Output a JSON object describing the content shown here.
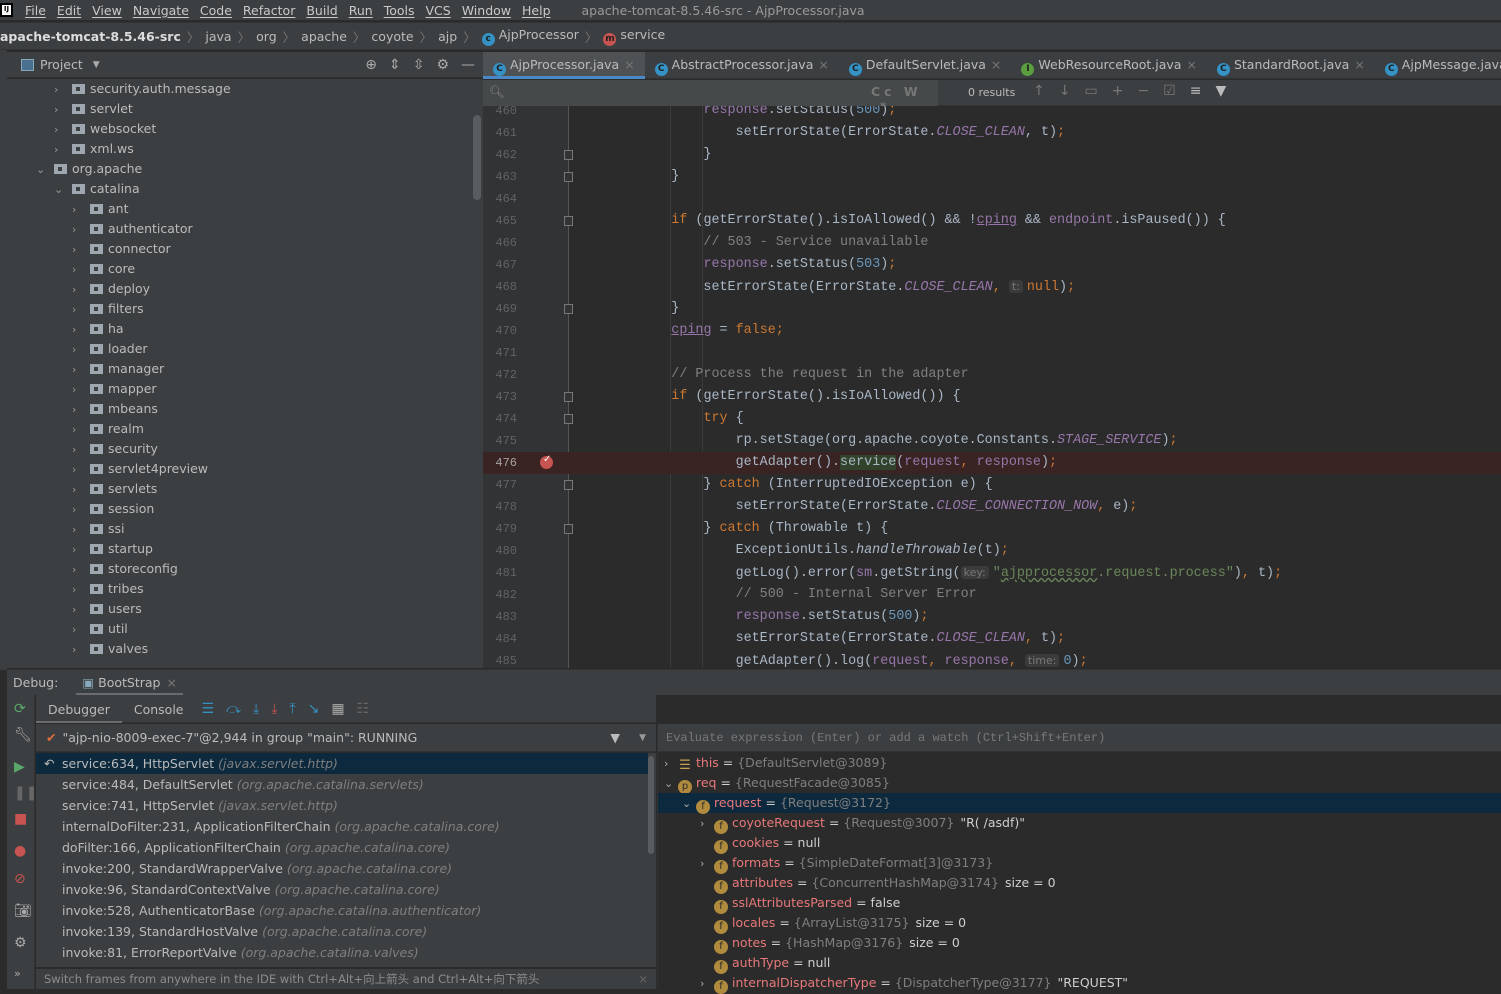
{
  "menu": {
    "items": [
      "File",
      "Edit",
      "View",
      "Navigate",
      "Code",
      "Refactor",
      "Build",
      "Run",
      "Tools",
      "VCS",
      "Window",
      "Help"
    ],
    "window_title": "apache-tomcat-8.5.46-src - AjpProcessor.java"
  },
  "breadcrumb": {
    "items": [
      "apache-tomcat-8.5.46-src",
      "java",
      "org",
      "apache",
      "coyote",
      "ajp"
    ],
    "class": "AjpProcessor",
    "method": "service"
  },
  "project": {
    "title": "Project",
    "tree": [
      {
        "label": "security.auth.message",
        "level": 2,
        "open": false
      },
      {
        "label": "servlet",
        "level": 2,
        "open": false
      },
      {
        "label": "websocket",
        "level": 2,
        "open": false
      },
      {
        "label": "xml.ws",
        "level": 2,
        "open": false
      },
      {
        "label": "org.apache",
        "level": 1,
        "open": true
      },
      {
        "label": "catalina",
        "level": 2,
        "open": true
      },
      {
        "label": "ant",
        "level": 3,
        "open": false
      },
      {
        "label": "authenticator",
        "level": 3,
        "open": false
      },
      {
        "label": "connector",
        "level": 3,
        "open": false
      },
      {
        "label": "core",
        "level": 3,
        "open": false
      },
      {
        "label": "deploy",
        "level": 3,
        "open": false
      },
      {
        "label": "filters",
        "level": 3,
        "open": false
      },
      {
        "label": "ha",
        "level": 3,
        "open": false
      },
      {
        "label": "loader",
        "level": 3,
        "open": false
      },
      {
        "label": "manager",
        "level": 3,
        "open": false
      },
      {
        "label": "mapper",
        "level": 3,
        "open": false
      },
      {
        "label": "mbeans",
        "level": 3,
        "open": false
      },
      {
        "label": "realm",
        "level": 3,
        "open": false
      },
      {
        "label": "security",
        "level": 3,
        "open": false
      },
      {
        "label": "servlet4preview",
        "level": 3,
        "open": false
      },
      {
        "label": "servlets",
        "level": 3,
        "open": false
      },
      {
        "label": "session",
        "level": 3,
        "open": false
      },
      {
        "label": "ssi",
        "level": 3,
        "open": false
      },
      {
        "label": "startup",
        "level": 3,
        "open": false
      },
      {
        "label": "storeconfig",
        "level": 3,
        "open": false
      },
      {
        "label": "tribes",
        "level": 3,
        "open": false
      },
      {
        "label": "users",
        "level": 3,
        "open": false
      },
      {
        "label": "util",
        "level": 3,
        "open": false
      },
      {
        "label": "valves",
        "level": 3,
        "open": false
      }
    ]
  },
  "tabs": [
    {
      "label": "AjpProcessor.java",
      "icon": "c",
      "active": true
    },
    {
      "label": "AbstractProcessor.java",
      "icon": "c"
    },
    {
      "label": "DefaultServlet.java",
      "icon": "c"
    },
    {
      "label": "WebResourceRoot.java",
      "icon": "i"
    },
    {
      "label": "StandardRoot.java",
      "icon": "c"
    },
    {
      "label": "AjpMessage.java",
      "icon": "c"
    }
  ],
  "search": {
    "value": "",
    "options": "Cc W .*",
    "results": "0 results"
  },
  "colors": {
    "keyword": "#cc7832",
    "field": "#9876aa",
    "number": "#6897bb",
    "string": "#6a8759",
    "comment": "#808080",
    "text": "#a9b7c6",
    "breakpoint": "#c75450",
    "accent": "#4a88c7"
  },
  "code": [
    {
      "n": "460",
      "t": [
        [
          "            ",
          "d"
        ],
        [
          "response",
          "f"
        ],
        [
          ".setStatus(",
          "d"
        ],
        [
          "500",
          "n"
        ],
        [
          ")",
          "d"
        ],
        [
          ";",
          "k"
        ]
      ]
    },
    {
      "n": "461",
      "t": [
        [
          "                setErrorState(ErrorState.",
          "d"
        ],
        [
          "CLOSE_CLEAN",
          "ci"
        ],
        [
          ", t)",
          "d"
        ],
        [
          ";",
          "k"
        ]
      ]
    },
    {
      "n": "462",
      "fold": true,
      "t": [
        [
          "            }",
          "d"
        ]
      ]
    },
    {
      "n": "463",
      "fold": true,
      "t": [
        [
          "        }",
          "d"
        ]
      ]
    },
    {
      "n": "464",
      "t": []
    },
    {
      "n": "465",
      "fold": true,
      "t": [
        [
          "        ",
          "d"
        ],
        [
          "if",
          "k"
        ],
        [
          " (getErrorState().isIoAllowed() && !",
          "d"
        ],
        [
          "cping",
          "fu"
        ],
        [
          " && ",
          "d"
        ],
        [
          "endpoint",
          "f"
        ],
        [
          ".isPaused()) {",
          "d"
        ]
      ]
    },
    {
      "n": "466",
      "t": [
        [
          "            // 503 - Service unavailable",
          "c"
        ]
      ]
    },
    {
      "n": "467",
      "t": [
        [
          "            ",
          "d"
        ],
        [
          "response",
          "f"
        ],
        [
          ".setStatus(",
          "d"
        ],
        [
          "503",
          "n"
        ],
        [
          ")",
          "d"
        ],
        [
          ";",
          "k"
        ]
      ]
    },
    {
      "n": "468",
      "t": [
        [
          "            setErrorState(ErrorState.",
          "d"
        ],
        [
          "CLOSE_CLEAN",
          "ci"
        ],
        [
          ",",
          "k"
        ],
        [
          " ",
          "d"
        ],
        [
          "t:",
          "h"
        ],
        [
          "null",
          "k"
        ],
        [
          ")",
          "d"
        ],
        [
          ";",
          "k"
        ]
      ]
    },
    {
      "n": "469",
      "fold": true,
      "t": [
        [
          "        }",
          "d"
        ]
      ]
    },
    {
      "n": "470",
      "t": [
        [
          "        ",
          "d"
        ],
        [
          "cping",
          "fu"
        ],
        [
          " = ",
          "d"
        ],
        [
          "false",
          "k"
        ],
        [
          ";",
          "k"
        ]
      ]
    },
    {
      "n": "471",
      "t": []
    },
    {
      "n": "472",
      "t": [
        [
          "        // Process the request in the adapter",
          "c"
        ]
      ]
    },
    {
      "n": "473",
      "fold": true,
      "t": [
        [
          "        ",
          "d"
        ],
        [
          "if",
          "k"
        ],
        [
          " (getErrorState().isIoAllowed()) {",
          "d"
        ]
      ]
    },
    {
      "n": "474",
      "fold": true,
      "t": [
        [
          "            ",
          "d"
        ],
        [
          "try",
          "k"
        ],
        [
          " {",
          "d"
        ]
      ]
    },
    {
      "n": "475",
      "t": [
        [
          "                rp.setStage(org.apache.coyote.Constants.",
          "d"
        ],
        [
          "STAGE_SERVICE",
          "ci"
        ],
        [
          ")",
          "d"
        ],
        [
          ";",
          "k"
        ]
      ]
    },
    {
      "n": "476",
      "bp": true,
      "t": [
        [
          "                getAdapter().",
          "d"
        ],
        [
          "service",
          "sel"
        ],
        [
          "(",
          "d"
        ],
        [
          "request",
          "f"
        ],
        [
          ", ",
          "k"
        ],
        [
          "response",
          "f"
        ],
        [
          ")",
          "d"
        ],
        [
          ";",
          "k"
        ]
      ]
    },
    {
      "n": "477",
      "fold": true,
      "t": [
        [
          "            } ",
          "d"
        ],
        [
          "catch",
          "k"
        ],
        [
          " (InterruptedIOException e) {",
          "d"
        ]
      ]
    },
    {
      "n": "478",
      "t": [
        [
          "                setErrorState(ErrorState.",
          "d"
        ],
        [
          "CLOSE_CONNECTION_NOW",
          "ci"
        ],
        [
          ",",
          "k"
        ],
        [
          " e)",
          "d"
        ],
        [
          ";",
          "k"
        ]
      ]
    },
    {
      "n": "479",
      "fold": true,
      "t": [
        [
          "            } ",
          "d"
        ],
        [
          "catch",
          "k"
        ],
        [
          " (Throwable t) {",
          "d"
        ]
      ]
    },
    {
      "n": "480",
      "t": [
        [
          "                ExceptionUtils.",
          "d"
        ],
        [
          "handleThrowable",
          "mi"
        ],
        [
          "(t)",
          "d"
        ],
        [
          ";",
          "k"
        ]
      ]
    },
    {
      "n": "481",
      "t": [
        [
          "                getLog().error(",
          "d"
        ],
        [
          "sm",
          "f"
        ],
        [
          ".getString(",
          "d"
        ],
        [
          "key:",
          "h"
        ],
        [
          "\"",
          "s"
        ],
        [
          "ajpprocessor",
          "sq"
        ],
        [
          ".request.process\"",
          "s"
        ],
        [
          ")",
          "d"
        ],
        [
          ",",
          "k"
        ],
        [
          " t)",
          "d"
        ],
        [
          ";",
          "k"
        ]
      ]
    },
    {
      "n": "482",
      "t": [
        [
          "                // 500 - Internal Server Error",
          "c"
        ]
      ]
    },
    {
      "n": "483",
      "t": [
        [
          "                ",
          "d"
        ],
        [
          "response",
          "f"
        ],
        [
          ".setStatus(",
          "d"
        ],
        [
          "500",
          "n"
        ],
        [
          ")",
          "d"
        ],
        [
          ";",
          "k"
        ]
      ]
    },
    {
      "n": "484",
      "t": [
        [
          "                setErrorState(ErrorState.",
          "d"
        ],
        [
          "CLOSE_CLEAN",
          "ci"
        ],
        [
          ",",
          "k"
        ],
        [
          " t)",
          "d"
        ],
        [
          ";",
          "k"
        ]
      ]
    },
    {
      "n": "485",
      "t": [
        [
          "                getAdapter().log(",
          "d"
        ],
        [
          "request",
          "f"
        ],
        [
          ",",
          "k"
        ],
        [
          " ",
          "d"
        ],
        [
          "response",
          "f"
        ],
        [
          ",",
          "k"
        ],
        [
          " ",
          "d"
        ],
        [
          "time:",
          "h"
        ],
        [
          "0",
          "n"
        ],
        [
          ")",
          "d"
        ],
        [
          ";",
          "k"
        ]
      ]
    }
  ],
  "debug": {
    "label": "Debug:",
    "session": "BootStrap",
    "tabs": [
      "Debugger",
      "Console"
    ],
    "thread": "\"ajp-nio-8009-exec-7\"@2,944 in group \"main\": RUNNING",
    "frames": [
      {
        "m": "service:634, HttpServlet",
        "p": "(javax.servlet.http)",
        "selected": true
      },
      {
        "m": "service:484, DefaultServlet",
        "p": "(org.apache.catalina.servlets)"
      },
      {
        "m": "service:741, HttpServlet",
        "p": "(javax.servlet.http)"
      },
      {
        "m": "internalDoFilter:231, ApplicationFilterChain",
        "p": "(org.apache.catalina.core)"
      },
      {
        "m": "doFilter:166, ApplicationFilterChain",
        "p": "(org.apache.catalina.core)"
      },
      {
        "m": "invoke:200, StandardWrapperValve",
        "p": "(org.apache.catalina.core)"
      },
      {
        "m": "invoke:96, StandardContextValve",
        "p": "(org.apache.catalina.core)"
      },
      {
        "m": "invoke:528, AuthenticatorBase",
        "p": "(org.apache.catalina.authenticator)"
      },
      {
        "m": "invoke:139, StandardHostValve",
        "p": "(org.apache.catalina.core)"
      },
      {
        "m": "invoke:81, ErrorReportValve",
        "p": "(org.apache.catalina.valves)"
      }
    ],
    "hint": "Switch frames from anywhere in the IDE with Ctrl+Alt+向上箭头 and Ctrl+Alt+向下箭头",
    "eval_placeholder": "Evaluate expression (Enter) or add a watch (Ctrl+Shift+Enter)",
    "variables": [
      {
        "lvl": 0,
        "arrow": ">",
        "icon": "list",
        "name": "this",
        "type": "{DefaultServlet@3089}",
        "val": ""
      },
      {
        "lvl": 0,
        "arrow": "v",
        "icon": "p",
        "name": "req",
        "type": "{RequestFacade@3085}",
        "val": ""
      },
      {
        "lvl": 1,
        "arrow": "v",
        "icon": "f",
        "name": "request",
        "type": "{Request@3172}",
        "val": "",
        "selected": true
      },
      {
        "lvl": 2,
        "arrow": ">",
        "icon": "f",
        "name": "coyoteRequest",
        "type": "{Request@3007}",
        "val": "\"R( /asdf)\""
      },
      {
        "lvl": 2,
        "arrow": "",
        "icon": "f",
        "name": "cookies",
        "type": "",
        "val": "null"
      },
      {
        "lvl": 2,
        "arrow": ">",
        "icon": "f",
        "name": "formats",
        "type": "{SimpleDateFormat[3]@3173}",
        "val": ""
      },
      {
        "lvl": 2,
        "arrow": "",
        "icon": "f",
        "name": "attributes",
        "type": "{ConcurrentHashMap@3174}",
        "val": "size = 0"
      },
      {
        "lvl": 2,
        "arrow": "",
        "icon": "f",
        "name": "sslAttributesParsed",
        "type": "",
        "val": "false"
      },
      {
        "lvl": 2,
        "arrow": "",
        "icon": "f",
        "name": "locales",
        "type": "{ArrayList@3175}",
        "val": "size = 0"
      },
      {
        "lvl": 2,
        "arrow": "",
        "icon": "f",
        "name": "notes",
        "type": "{HashMap@3176}",
        "val": "size = 0"
      },
      {
        "lvl": 2,
        "arrow": "",
        "icon": "f",
        "name": "authType",
        "type": "",
        "val": "null"
      },
      {
        "lvl": 2,
        "arrow": ">",
        "icon": "f",
        "name": "internalDispatcherType",
        "type": "{DispatcherType@3177}",
        "val": "\"REQUEST\""
      }
    ]
  }
}
